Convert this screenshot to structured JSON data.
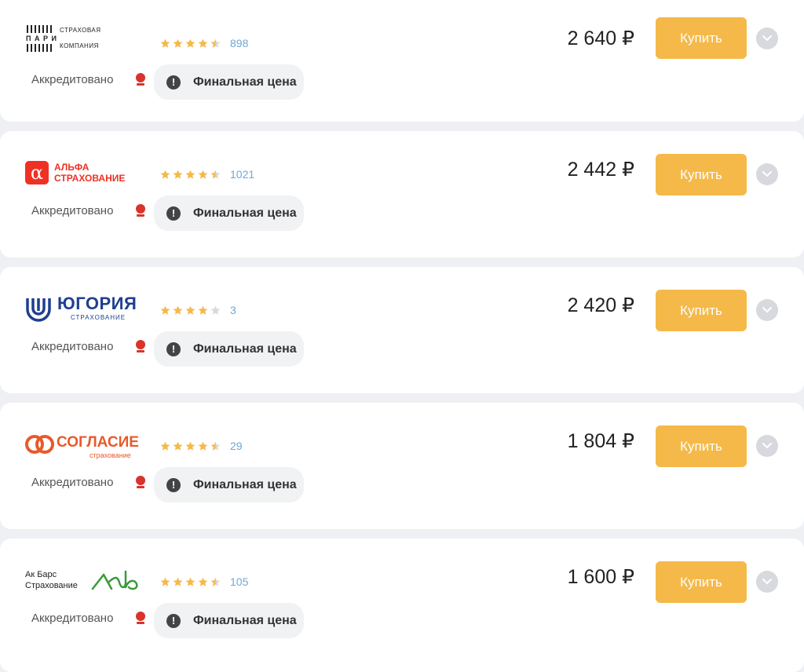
{
  "offers": [
    {
      "company": "Пари Страховая компания",
      "logo_lines": [
        "СТРАХОВАЯ",
        "П А Р И",
        "КОМПАНИЯ"
      ],
      "rating": 4.5,
      "reviews": "898",
      "accredited_label": "Аккредитовано",
      "final_price_label": "Финальная цена",
      "price": "2 640 ₽",
      "buy_label": "Купить"
    },
    {
      "company": "Альфа Страхование",
      "logo_lines": [
        "АЛЬФА",
        "СТРАХОВАНИЕ"
      ],
      "logo_color": "#ef3124",
      "rating": 4.5,
      "reviews": "1021",
      "accredited_label": "Аккредитовано",
      "final_price_label": "Финальная цена",
      "price": "2 442 ₽",
      "buy_label": "Купить"
    },
    {
      "company": "Югория Страхование",
      "logo_lines": [
        "ЮГОРИЯ",
        "СТРАХОВАНИЕ"
      ],
      "logo_color": "#1f3f8f",
      "rating": 4,
      "reviews": "3",
      "accredited_label": "Аккредитовано",
      "final_price_label": "Финальная цена",
      "price": "2 420 ₽",
      "buy_label": "Купить"
    },
    {
      "company": "Согласие страхование",
      "logo_lines": [
        "СОГЛАСИЕ",
        "страхование"
      ],
      "logo_color": "#e85a2a",
      "rating": 4.5,
      "reviews": "29",
      "accredited_label": "Аккредитовано",
      "final_price_label": "Финальная цена",
      "price": "1 804 ₽",
      "buy_label": "Купить"
    },
    {
      "company": "Ак Барс Страхование",
      "logo_lines": [
        "Ак Барс",
        "Страхование"
      ],
      "logo_color": "#3a9a3a",
      "rating": 4.5,
      "reviews": "105",
      "accredited_label": "Аккредитовано",
      "final_price_label": "Финальная цена",
      "price": "1 600 ₽",
      "buy_label": "Купить"
    }
  ],
  "colors": {
    "buy_button": "#f5b94a",
    "star": "#f5b94a",
    "star_empty": "#d9d9d9",
    "review_count": "#6ea7d9",
    "medal": "#d9332b"
  }
}
